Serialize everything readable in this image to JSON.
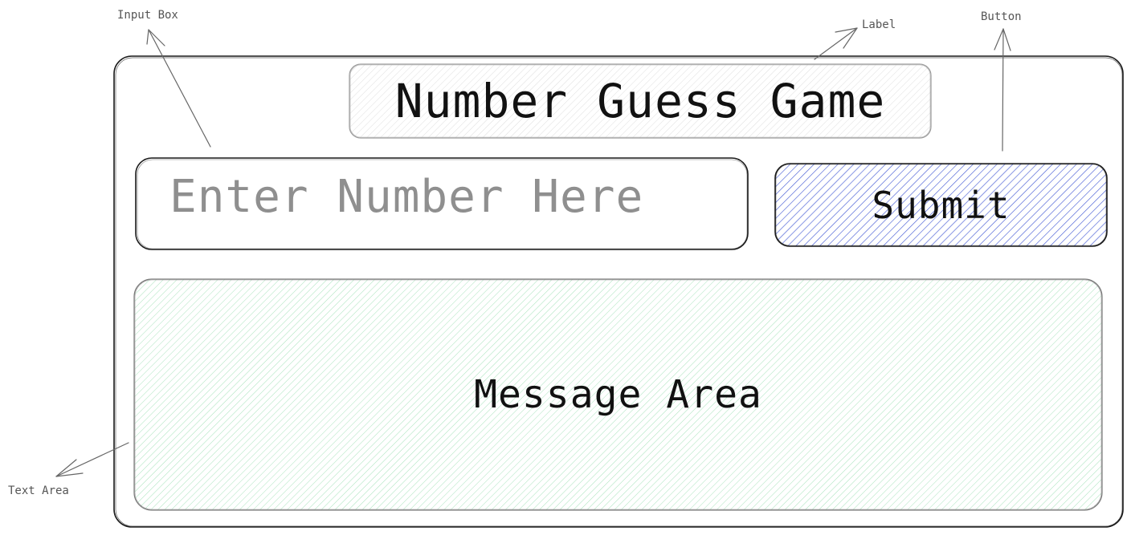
{
  "annotations": {
    "input_box": "Input Box",
    "label": "Label",
    "button": "Button",
    "text_area": "Text Area"
  },
  "app": {
    "title": "Number Guess Game",
    "input_placeholder": "Enter Number Here",
    "submit_label": "Submit",
    "message_area": "Message Area"
  },
  "colors": {
    "stroke": "#1a1a1a",
    "button_fill": "#4a5fd6",
    "message_fill": "#7fd6a0",
    "label_fill": "#bdbdbd",
    "placeholder": "#8f8f8f"
  }
}
